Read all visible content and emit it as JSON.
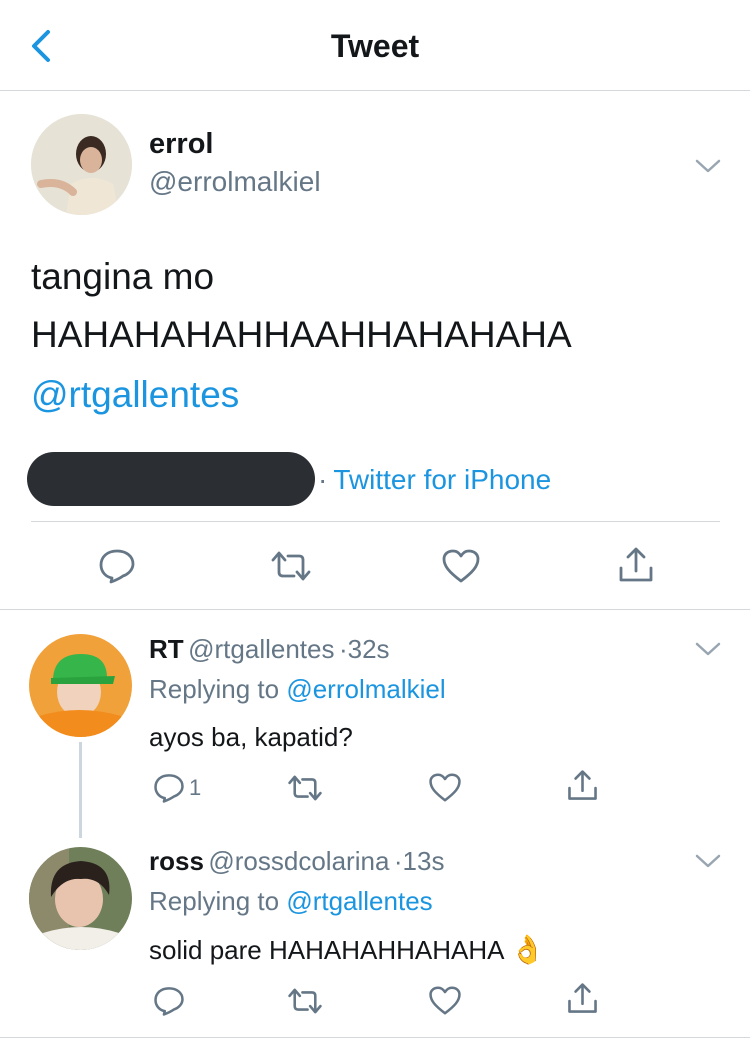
{
  "header": {
    "title": "Tweet"
  },
  "main_tweet": {
    "name": "errol",
    "handle": "@errolmalkiel",
    "text_line1": "tangina mo",
    "text_line2": "HAHAHAHAHHAAHHAHAHAHA",
    "mention": "@rtgallentes",
    "source_sep": "·",
    "source": "Twitter for iPhone"
  },
  "replies": [
    {
      "name": "RT",
      "handle": "@rtgallentes",
      "sep": "·",
      "time": "32s",
      "replying_prefix": "Replying to",
      "replying_to": "@errolmalkiel",
      "text": "ayos ba, kapatid?",
      "reply_count": "1"
    },
    {
      "name": "ross",
      "handle": "@rossdcolarina",
      "sep": "·",
      "time": "13s",
      "replying_prefix": "Replying to",
      "replying_to": "@rtgallentes",
      "text": "solid pare HAHAHAHHAHAHA",
      "emoji": "👌"
    }
  ],
  "icons": [
    "back-chevron-icon",
    "chevron-down-icon",
    "reply-icon",
    "retweet-icon",
    "like-icon",
    "share-icon"
  ],
  "colors": {
    "accent": "#1b95e0",
    "secondary_text": "#657786",
    "divider": "#d6d9dc"
  }
}
